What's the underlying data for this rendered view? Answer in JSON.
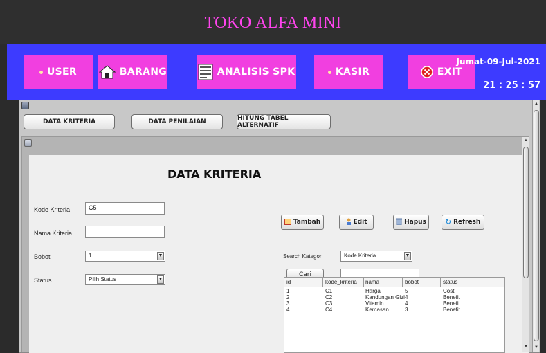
{
  "app": {
    "title": "TOKO ALFA MINI"
  },
  "menu": {
    "user": "USER",
    "barang": "BARANG",
    "analisis": "ANALISIS SPK",
    "kasir": "KASIR",
    "exit": "EXIT"
  },
  "datetime": {
    "date": "Jumat-09-Jul-2021",
    "time": "21 : 25 : 57"
  },
  "tabs": {
    "data_kriteria": "DATA KRITERIA",
    "data_penilaian": "DATA PENILAIAN",
    "hitung": "HITUNG TABEL ALTERNATIF"
  },
  "form": {
    "title": "DATA KRITERIA",
    "kode_label": "Kode Kriteria",
    "kode_value": "C5",
    "nama_label": "Nama Kriteria",
    "nama_value": "",
    "bobot_label": "Bobot",
    "bobot_value": "1",
    "status_label": "Status",
    "status_value": "Pilih Status"
  },
  "actions": {
    "tambah": "Tambah",
    "edit": "Edit",
    "hapus": "Hapus",
    "refresh": "Refresh"
  },
  "search": {
    "label": "Search Kategori",
    "category_value": "Kode Kriteria",
    "button": "Cari",
    "query": ""
  },
  "table": {
    "columns": [
      "id",
      "kode_kriteria",
      "nama",
      "bobot",
      "status"
    ],
    "rows": [
      [
        "1",
        "C1",
        "Harga",
        "5",
        "Cost"
      ],
      [
        "2",
        "C2",
        "Kandungan Gizi",
        "4",
        "Benefit"
      ],
      [
        "3",
        "C3",
        "Vitamin",
        "4",
        "Benefit"
      ],
      [
        "4",
        "C4",
        "Kemasan",
        "3",
        "Benefit"
      ]
    ]
  },
  "colors": {
    "title_text": "#ff44ee",
    "menu_bar": "#3d3bff",
    "menu_button": "#f13fe0"
  }
}
